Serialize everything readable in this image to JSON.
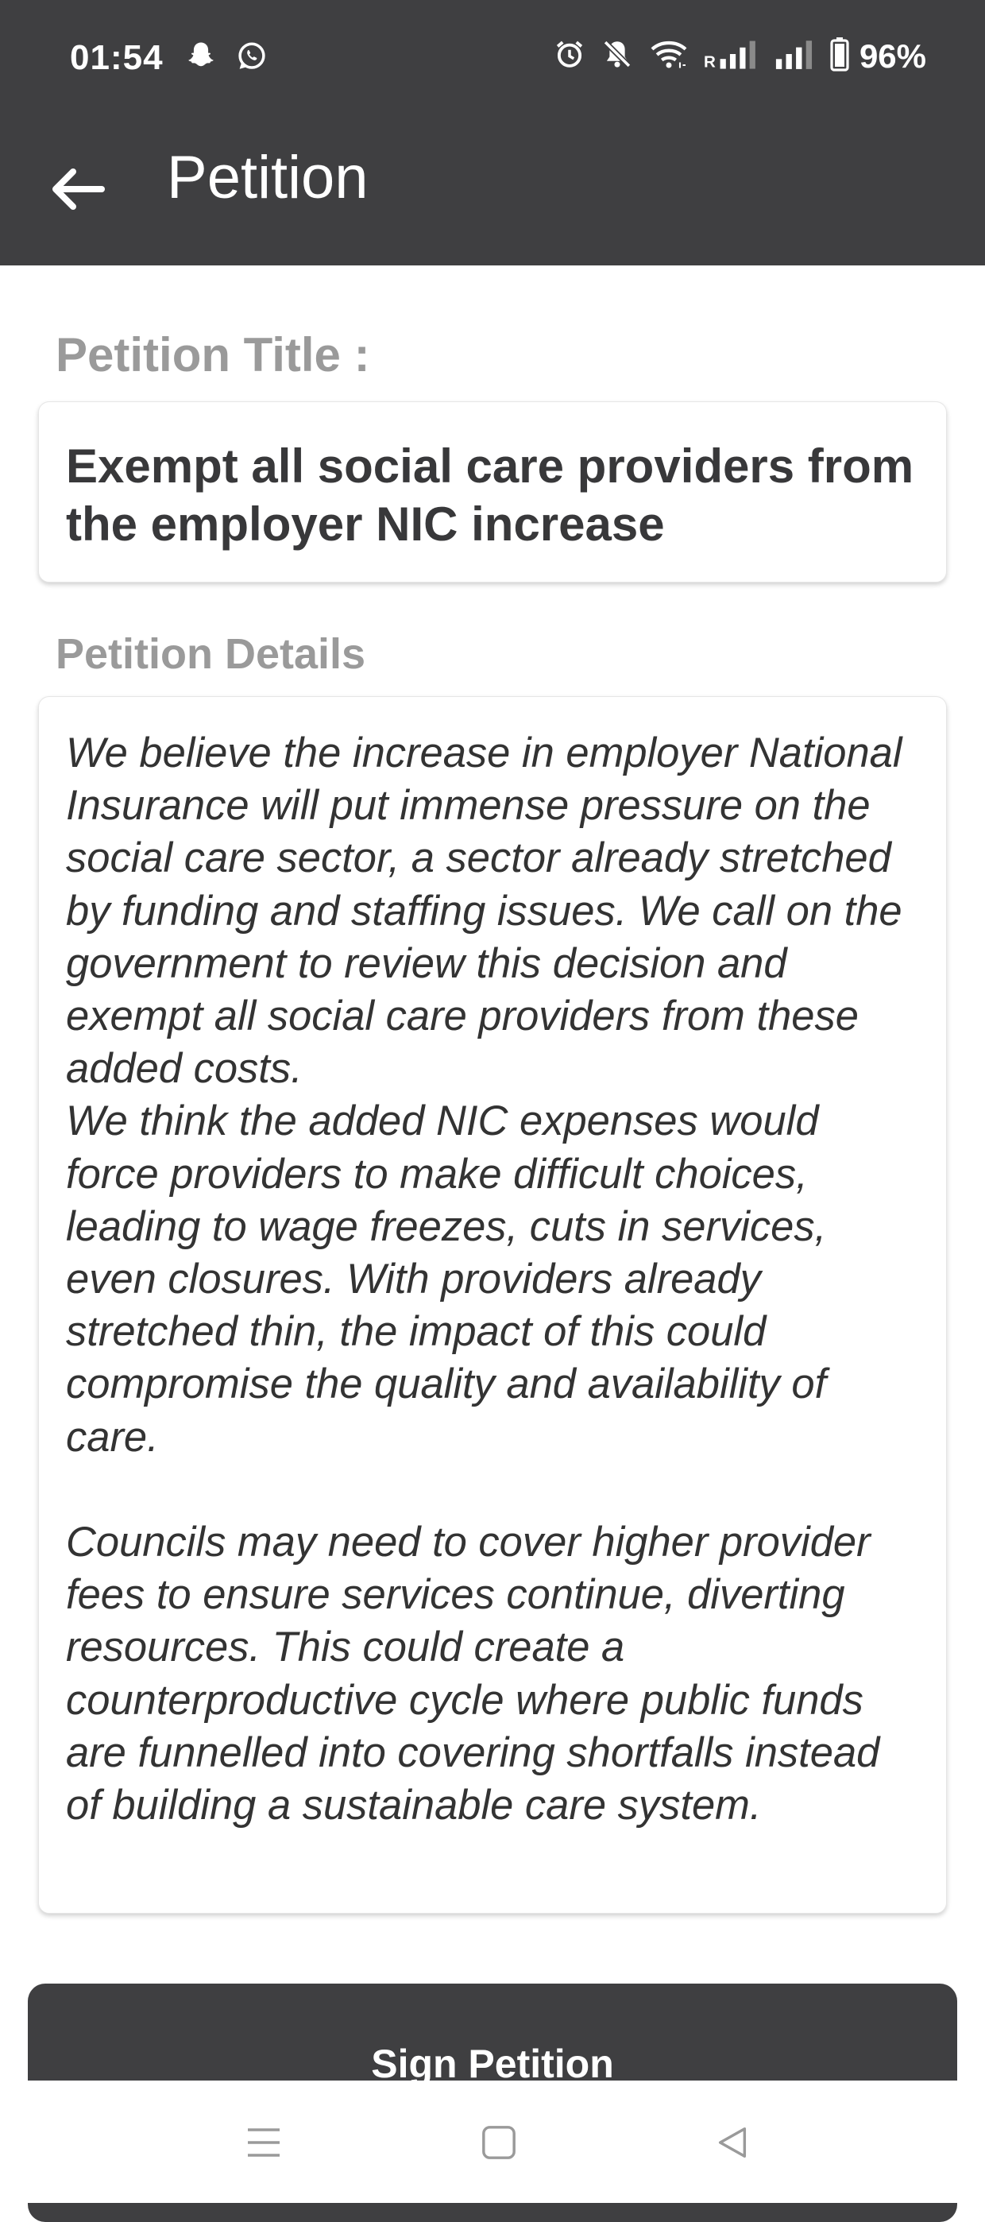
{
  "status_bar": {
    "time": "01:54",
    "battery": "96%",
    "left_icons": [
      "snapchat-icon",
      "whatsapp-icon"
    ],
    "right_icons": [
      "alarm-icon",
      "mute-icon",
      "wifi-icon",
      "signal-icon",
      "signal-icon",
      "battery-icon"
    ]
  },
  "toolbar": {
    "back_icon": "arrow-left-icon",
    "title": "Petition"
  },
  "petition": {
    "title_label": "Petition Title :",
    "title": "Exempt all social care providers from the employer NIC increase",
    "details_label": "Petition Details",
    "details": "We believe the increase in employer National Insurance will put immense pressure on the social care sector, a sector already stretched by funding and staffing issues. We call on the government to review this decision and exempt all social care providers from these added costs.\nWe think the added NIC expenses would force providers to make difficult choices, leading to wage freezes, cuts in services, even closures. With providers already stretched thin, the impact of this could compromise the quality and availability of care.\n\nCouncils may need to cover higher provider fees to ensure services continue, diverting resources. This could create a counterproductive cycle where public funds are funnelled into covering shortfalls instead of building a sustainable care system."
  },
  "actions": {
    "sign_label": "Sign Petition"
  },
  "nav_bar": {
    "icons": [
      "menu-icon",
      "home-icon",
      "back-triangle-icon"
    ]
  },
  "colors": {
    "appbar": "#3f3f41",
    "label": "#9a9a9a",
    "text": "#333333",
    "background": "#ffffff"
  }
}
